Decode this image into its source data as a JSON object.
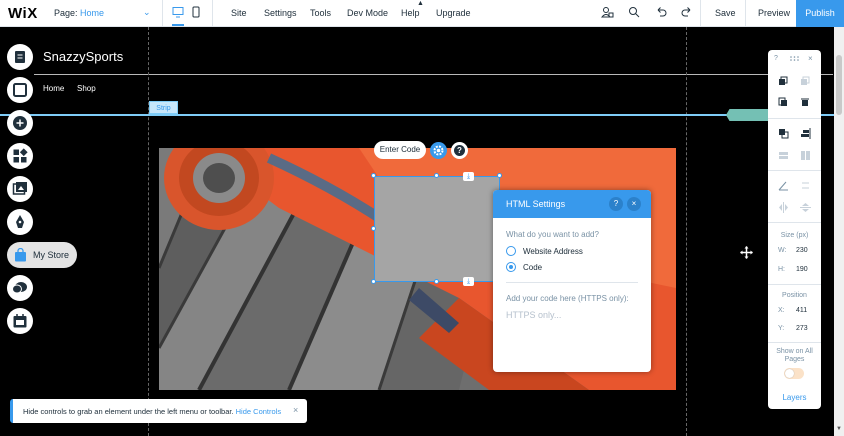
{
  "brand": {
    "logo": "WiX",
    "accent": "#3899ec"
  },
  "topbar": {
    "page_label": "Page:",
    "page_value": "Home",
    "menu": [
      "Site",
      "Settings",
      "Tools",
      "Dev Mode",
      "Help",
      "Upgrade"
    ],
    "save": "Save",
    "preview": "Preview",
    "publish": "Publish"
  },
  "site": {
    "name": "SnazzySports",
    "nav": [
      "Home",
      "Shop"
    ],
    "strip_label": "Strip"
  },
  "left_toolbar": {
    "icons": [
      "pages-icon",
      "background-icon",
      "add-icon",
      "app-market-icon",
      "media-icon",
      "blog-icon",
      "store-icon",
      "chat-icon",
      "bookings-icon"
    ],
    "store_label": "My Store"
  },
  "element": {
    "enter_code": "Enter Code"
  },
  "html_settings": {
    "title": "HTML Settings",
    "help": "?",
    "close": "×",
    "question": "What do you want to add?",
    "options": [
      "Website Address",
      "Code"
    ],
    "selected": "Code",
    "code_label": "Add your code here (HTTPS only):",
    "code_placeholder": "HTTPS only..."
  },
  "right_panel": {
    "help": "?",
    "size_title": "Size (px)",
    "w_key": "W:",
    "w": "230",
    "h_key": "H:",
    "h": "190",
    "position_title": "Position",
    "x_key": "X:",
    "x": "411",
    "y_key": "Y:",
    "y": "273",
    "show_all": "Show on All Pages",
    "layers": "Layers"
  },
  "toast": {
    "message": "Hide controls to grab an element under the left menu or toolbar.",
    "link": "Hide Controls",
    "close": "×"
  }
}
